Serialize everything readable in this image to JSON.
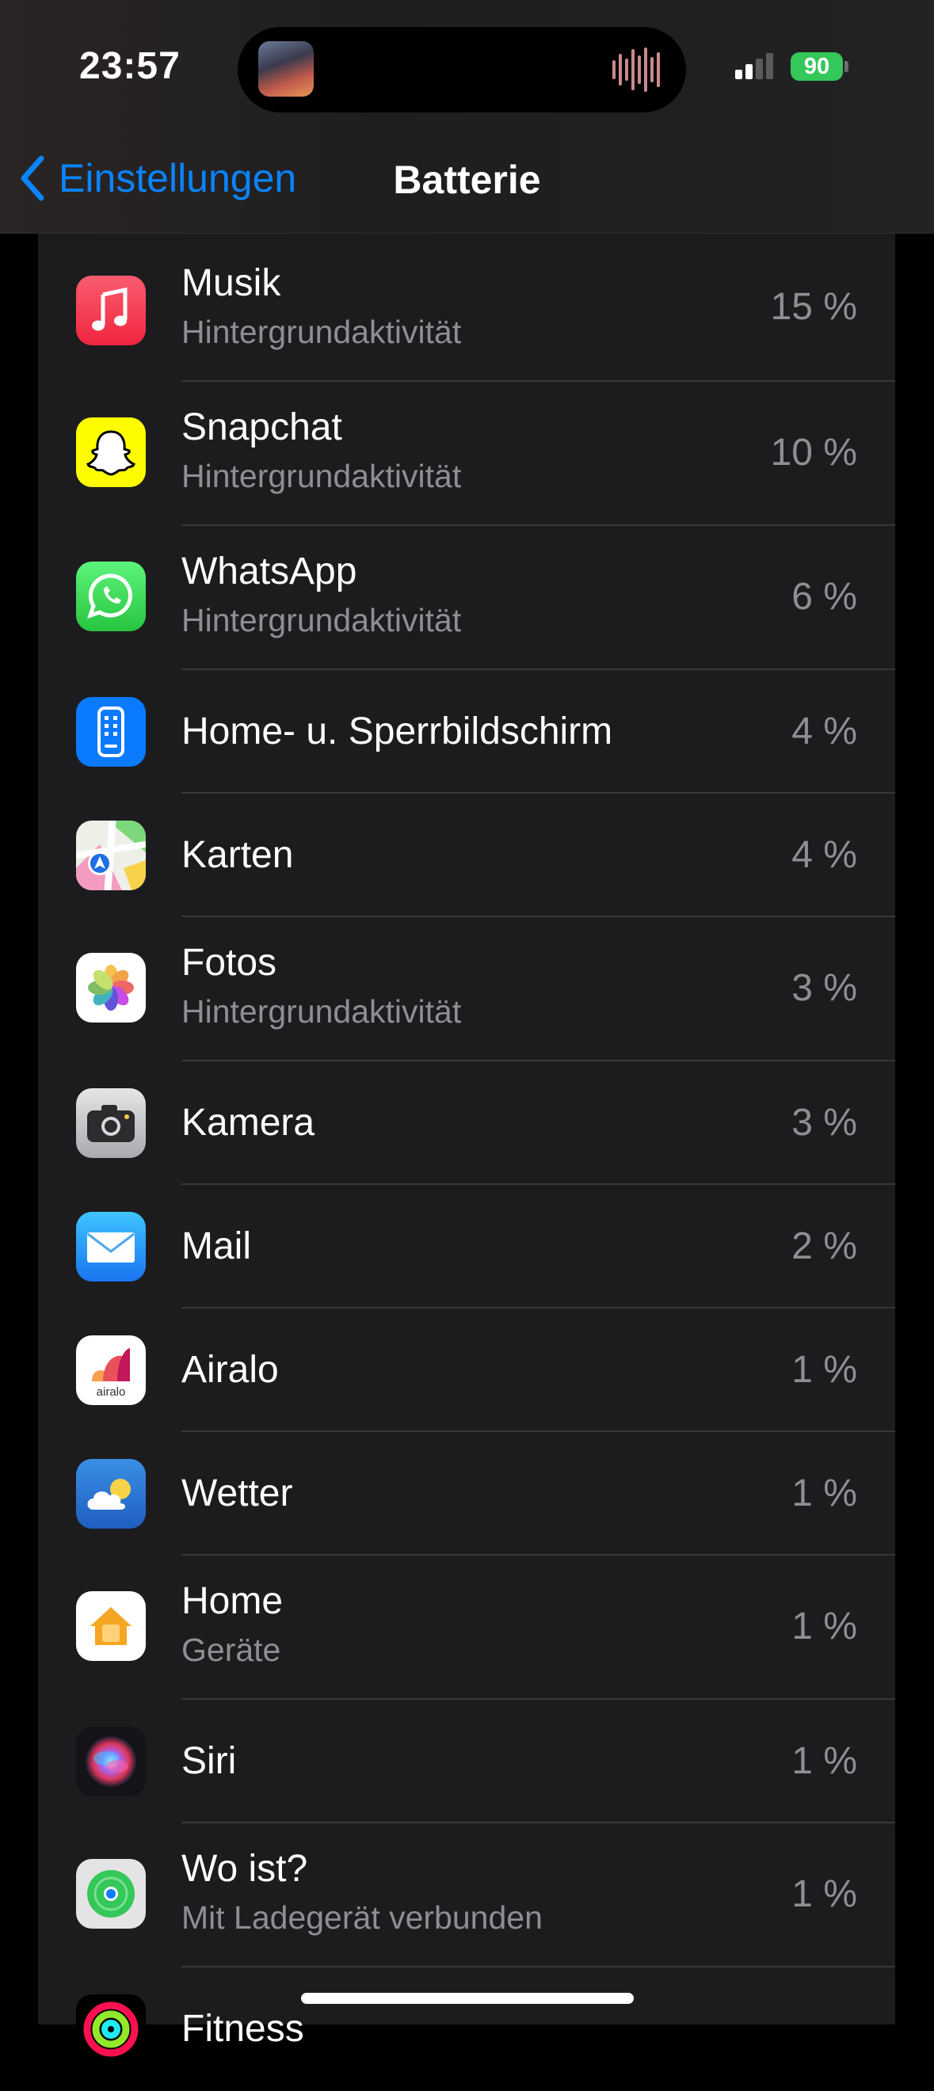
{
  "status_bar": {
    "time": "23:57",
    "battery_percent": "90"
  },
  "nav": {
    "back_label": "Einstellungen",
    "title": "Batterie"
  },
  "apps": [
    {
      "name": "Musik",
      "subtitle": "Hintergrundaktivität",
      "percent": "15 %",
      "icon": "music-icon"
    },
    {
      "name": "Snapchat",
      "subtitle": "Hintergrundaktivität",
      "percent": "10 %",
      "icon": "snapchat-icon"
    },
    {
      "name": "WhatsApp",
      "subtitle": "Hintergrundaktivität",
      "percent": "6 %",
      "icon": "whatsapp-icon"
    },
    {
      "name": "Home- u. Sperrbildschirm",
      "subtitle": "",
      "percent": "4 %",
      "icon": "home-screen-icon"
    },
    {
      "name": "Karten",
      "subtitle": "",
      "percent": "4 %",
      "icon": "maps-icon"
    },
    {
      "name": "Fotos",
      "subtitle": "Hintergrundaktivität",
      "percent": "3 %",
      "icon": "photos-icon"
    },
    {
      "name": "Kamera",
      "subtitle": "",
      "percent": "3 %",
      "icon": "camera-icon"
    },
    {
      "name": "Mail",
      "subtitle": "",
      "percent": "2 %",
      "icon": "mail-icon"
    },
    {
      "name": "Airalo",
      "subtitle": "",
      "percent": "1 %",
      "icon": "airalo-icon",
      "icon_text": "airalo"
    },
    {
      "name": "Wetter",
      "subtitle": "",
      "percent": "1 %",
      "icon": "weather-icon"
    },
    {
      "name": "Home",
      "subtitle": "Geräte",
      "percent": "1 %",
      "icon": "home-app-icon"
    },
    {
      "name": "Siri",
      "subtitle": "",
      "percent": "1 %",
      "icon": "siri-icon"
    },
    {
      "name": "Wo ist?",
      "subtitle": "Mit Ladegerät verbunden",
      "percent": "1 %",
      "icon": "find-my-icon"
    },
    {
      "name": "Fitness",
      "subtitle": "",
      "percent": "",
      "icon": "fitness-icon"
    }
  ],
  "colors": {
    "accent": "#0a84ff",
    "battery": "#34c759",
    "secondary_text": "#8e8e93"
  }
}
